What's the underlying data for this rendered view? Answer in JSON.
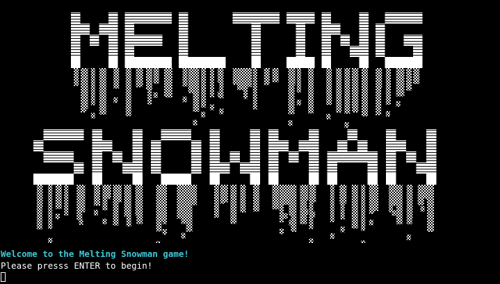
{
  "terminal": {
    "art_lines": [
      "MELTING",
      "SNOWMAN"
    ],
    "welcome_text": "Welcome to the Melting Snowman game!",
    "prompt_text": "Please presss ENTER to begin!"
  },
  "colors": {
    "background": "#000000",
    "art": "#ffffff",
    "welcome": "#3fc8d6",
    "prompt": "#ffffff"
  }
}
